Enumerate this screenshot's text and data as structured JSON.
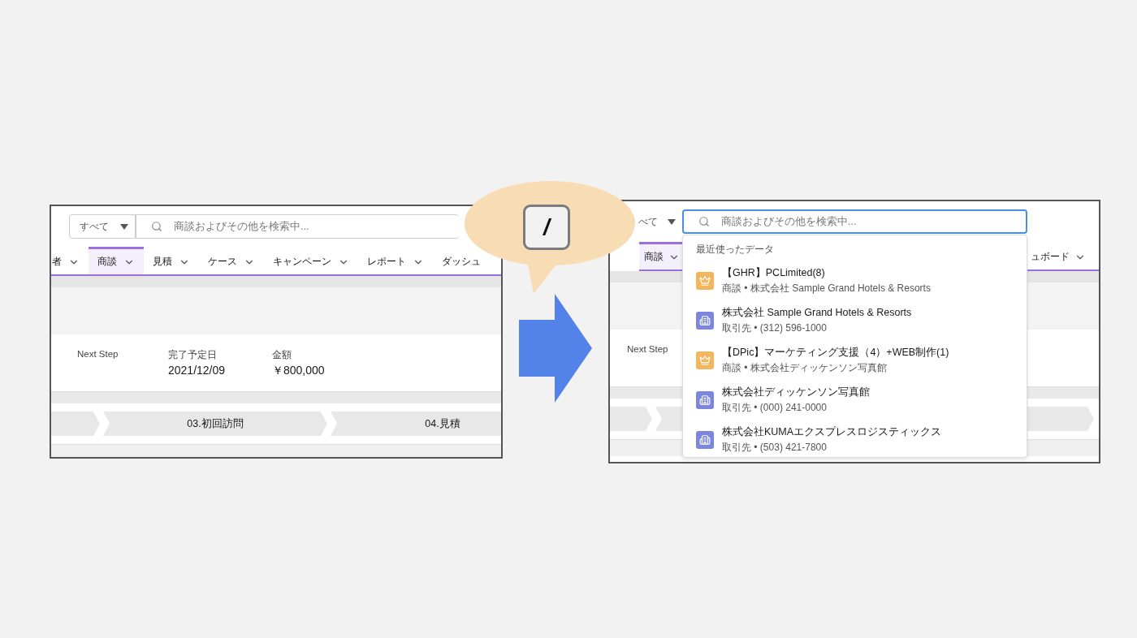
{
  "left_screen": {
    "scope_select": "すべて",
    "search": {
      "placeholder": "商談およびその他を検索中..."
    },
    "tabs": [
      {
        "label": "者",
        "selected": false
      },
      {
        "label": "商談",
        "selected": true
      },
      {
        "label": "見積",
        "selected": false
      },
      {
        "label": "ケース",
        "selected": false
      },
      {
        "label": "キャンペーン",
        "selected": false
      },
      {
        "label": "レポート",
        "selected": false
      },
      {
        "label": "ダッシュ",
        "selected": false
      }
    ],
    "fields": [
      {
        "label": "Next Step"
      },
      {
        "label": "完了予定日",
        "value": "2021/12/09"
      },
      {
        "label": "金額",
        "value": "￥800,000"
      }
    ],
    "path_steps": [
      "03.初回訪問",
      "04.見積"
    ]
  },
  "shortcut_key": "/",
  "right_screen": {
    "scope_select": "べて",
    "search": {
      "placeholder": "商談およびその他を検索中...",
      "focused": true
    },
    "tabs": [
      {
        "label": "商談",
        "selected": true
      },
      {
        "label": "ュボード",
        "selected": false
      }
    ],
    "fields": [
      {
        "label": "Next Step"
      }
    ],
    "recent": {
      "heading": "最近使ったデータ",
      "items": [
        {
          "kind": "opportunity",
          "title": "【GHR】PCLimited(8)",
          "subtitle": "商談 • 株式会社 Sample Grand Hotels & Resorts"
        },
        {
          "kind": "account",
          "title": "株式会社 Sample Grand Hotels & Resorts",
          "subtitle": "取引先 • (312) 596-1000"
        },
        {
          "kind": "opportunity",
          "title": "【DPic】マーケティング支援（4）+WEB制作(1)",
          "subtitle": "商談 • 株式会社ディッケンソン写真館"
        },
        {
          "kind": "account",
          "title": "株式会社ディッケンソン写真館",
          "subtitle": "取引先 • (000) 241-0000"
        },
        {
          "kind": "account",
          "title": "株式会社KUMAエクスプレスロジスティックス",
          "subtitle": "取引先 • (503) 421-7800"
        }
      ]
    }
  }
}
